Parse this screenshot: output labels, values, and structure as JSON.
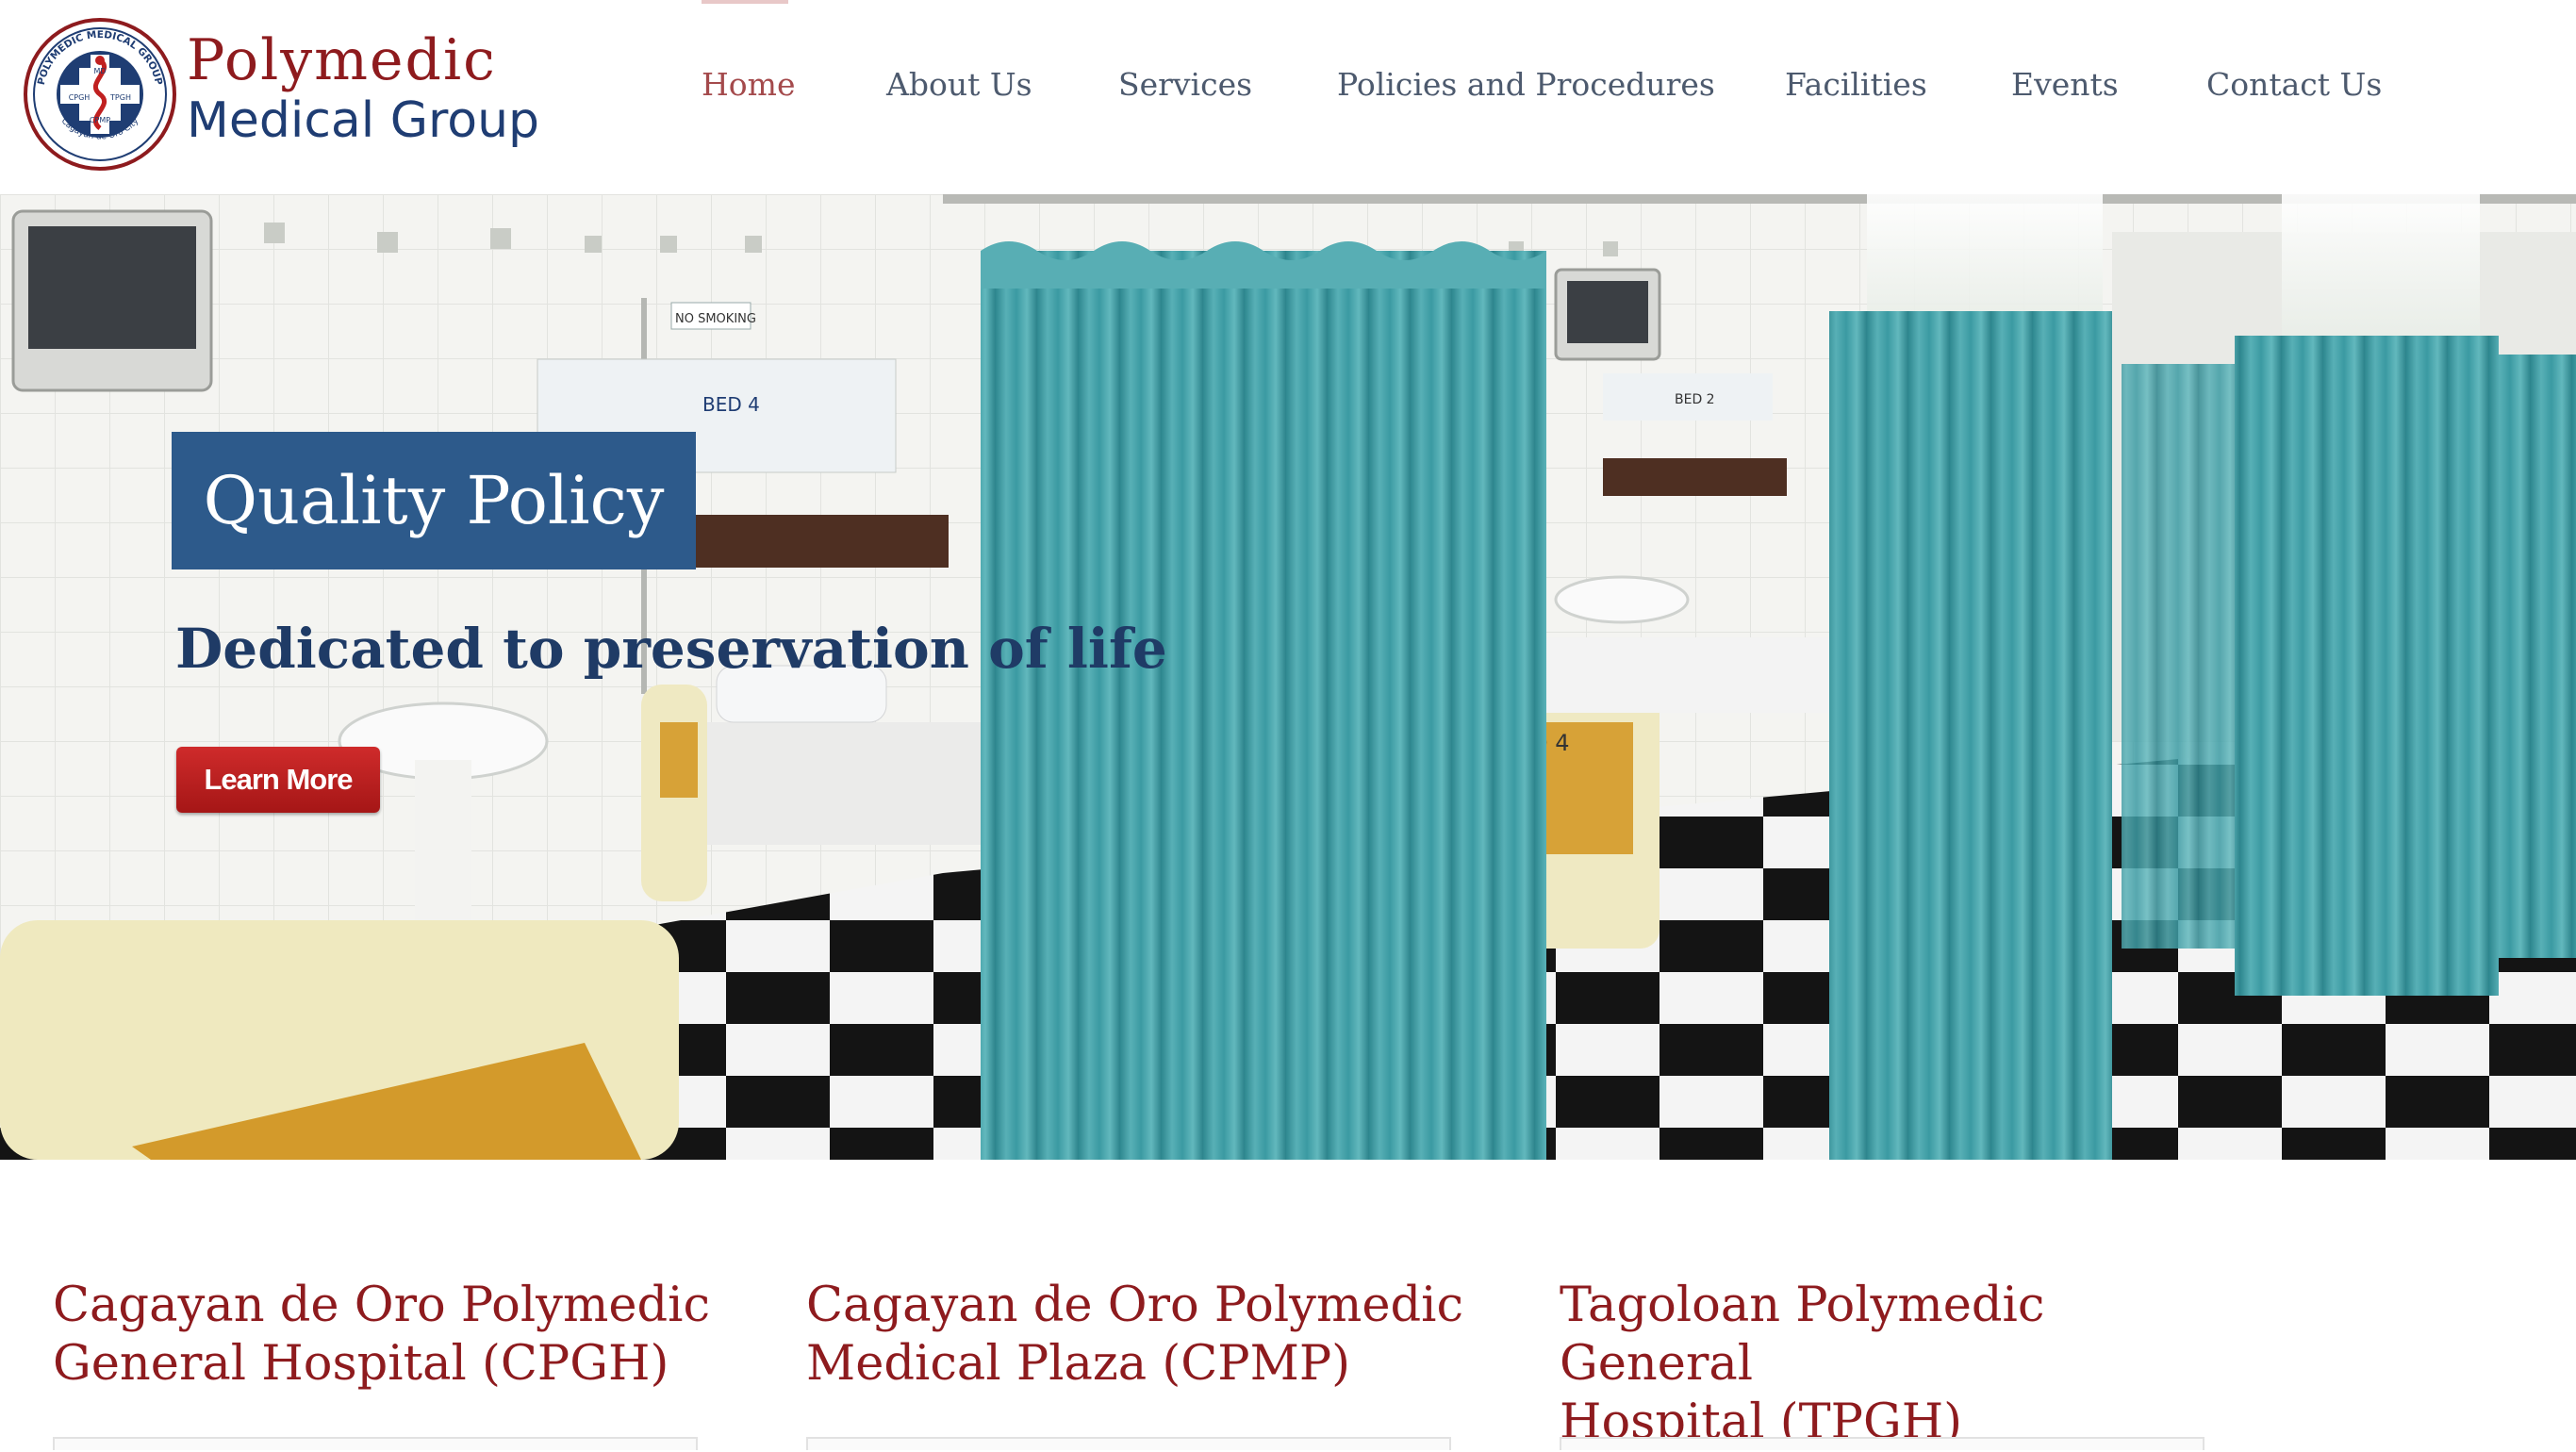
{
  "brand": {
    "name_line1": "Polymedic",
    "name_line2": "Medical Group",
    "seal": {
      "ring_text": "POLYMEDIC MEDICAL GROUP",
      "bottom_text": "Cagayan de Oro City",
      "quadrants": [
        "MD",
        "CPGH",
        "TPGH",
        "CPMP"
      ]
    }
  },
  "nav": {
    "items": [
      {
        "label": "Home",
        "active": true
      },
      {
        "label": "About Us",
        "active": false
      },
      {
        "label": "Services",
        "active": false
      },
      {
        "label": "Policies and Procedures",
        "active": false
      },
      {
        "label": "Facilities",
        "active": false
      },
      {
        "label": "Events",
        "active": false
      },
      {
        "label": "Contact Us",
        "active": false
      }
    ]
  },
  "hero": {
    "title": "Quality Policy",
    "subtitle": "Dedicated to preservation of life",
    "button_label": "Learn More",
    "photo_signs": [
      "BED 4",
      "NO SMOKING",
      "ED 4",
      "BED 2"
    ]
  },
  "hospitals": [
    {
      "name_line1": "Cagayan de Oro Polymedic",
      "name_line2": "General Hospital (CPGH)"
    },
    {
      "name_line1": "Cagayan de Oro Polymedic",
      "name_line2": "Medical Plaza (CPMP)"
    },
    {
      "name_line1": "Tagoloan Polymedic General",
      "name_line2": "Hospital (TPGH)"
    }
  ],
  "colors": {
    "brand_red": "#8e1b1e",
    "brand_blue": "#1f3d73",
    "nav_text": "#4d5a6e",
    "nav_active": "#a44a4c",
    "hero_title_bg": "#2d5a8b",
    "button_red": "#c02020",
    "curtain_teal": "#3d9aa2"
  },
  "icons": {
    "logo": "medical-seal-icon"
  }
}
